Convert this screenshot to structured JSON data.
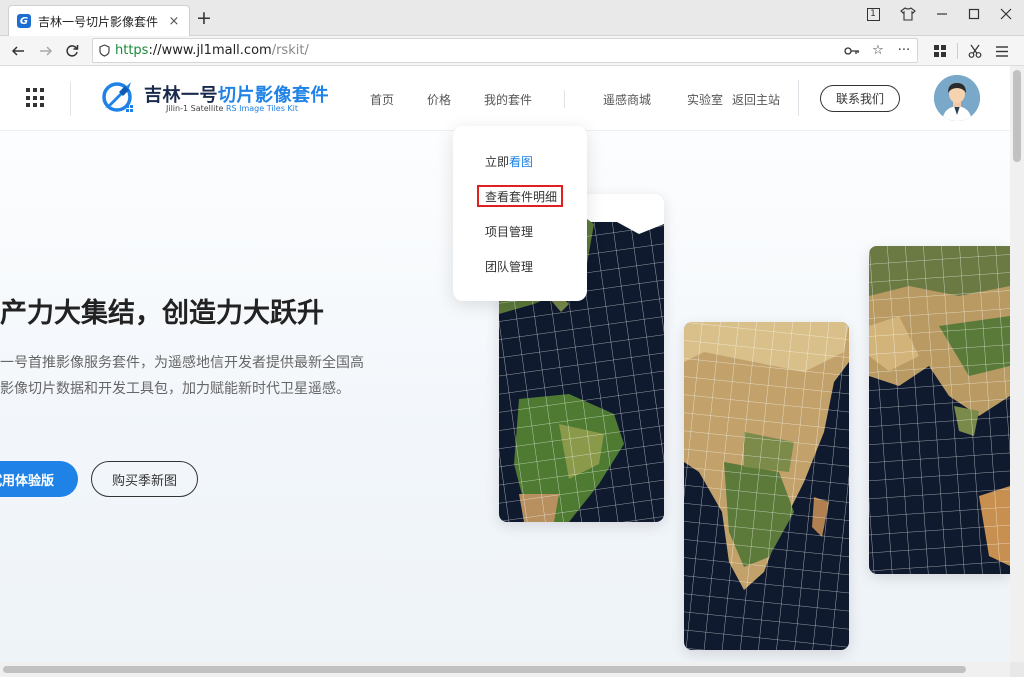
{
  "browser": {
    "tab_title": "吉林一号切片影像套件",
    "tab_close": "×",
    "new_tab": "+",
    "badge_number": "1",
    "url_scheme": "https",
    "url_host": "://www.jl1mall.com",
    "url_path": "/rskit/",
    "icons": [
      "back-icon",
      "forward-icon",
      "reload-icon",
      "shield-icon",
      "key-icon",
      "star-icon",
      "more-icon",
      "grid-icon",
      "scissors-icon",
      "menu-icon"
    ]
  },
  "header": {
    "logo_cn_dark": "吉林一号",
    "logo_cn_blue": "切片影像套件",
    "logo_en_dark": "Jilin-1  Satellite ",
    "logo_en_blue": "RS Image Tiles Kit",
    "nav": {
      "home": "首页",
      "price": "价格",
      "my_kits": "我的套件",
      "mall": "遥感商城",
      "lab": "实验室",
      "back_main": "返回主站"
    },
    "contact": "联系我们"
  },
  "dropdown": {
    "items": [
      {
        "prefix": "立即",
        "highlight": "看图"
      },
      {
        "prefix": "查看套件明细",
        "highlight": ""
      },
      {
        "prefix": "项目管理",
        "highlight": ""
      },
      {
        "prefix": "团队管理",
        "highlight": ""
      }
    ]
  },
  "hero": {
    "title": "产力大集结，创造力大跃升",
    "desc_line1": "一号首推影像服务套件，为遥感地信开发者提供最新全国高",
    "desc_line2": "影像切片数据和开发工具包，加力赋能新时代卫星遥感。",
    "btn_trial": "试用体验版",
    "btn_buy": "购买季新图"
  },
  "colors": {
    "accent": "#1e82e6",
    "highlight_box": "#e02020",
    "ocean": "#0f1a2e"
  }
}
